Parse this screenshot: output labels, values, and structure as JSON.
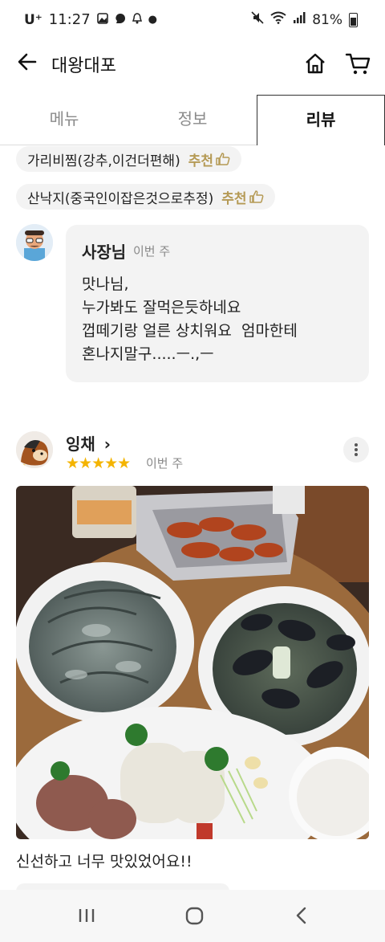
{
  "status": {
    "carrier": "U⁺",
    "time": "11:27",
    "battery": "81%",
    "left_icons": [
      "gallery-icon",
      "notification-icon",
      "bell-icon",
      "dot-icon"
    ],
    "right_icons": [
      "mute-icon",
      "wifi-icon",
      "signal-icon",
      "battery-icon"
    ]
  },
  "appbar": {
    "title": "대왕대포",
    "icons": [
      "back-arrow-icon",
      "home-icon",
      "cart-icon"
    ]
  },
  "tabs": [
    {
      "label": "메뉴",
      "active": false
    },
    {
      "label": "정보",
      "active": false
    },
    {
      "label": "리뷰",
      "active": true
    }
  ],
  "menu_chips": [
    {
      "name": "가리비찜(강추,이건더편해)",
      "rec": "추천"
    },
    {
      "name": "산낙지(중국인이잡은것으로추정)",
      "rec": "추천"
    }
  ],
  "owner_reply": {
    "name": "사장님",
    "when": "이번 주",
    "lines": [
      "맛나님,",
      "누가봐도 잘먹은듯하네요",
      "껍떼기랑 얼른 상치워요  엄마한테",
      "혼나지말구.....ㅡ.,ㅡ"
    ]
  },
  "review": {
    "reviewer": "잉채",
    "chevron": "›",
    "rating": 5,
    "stars": "★★★★★",
    "when": "이번 주",
    "text": "신선하고 너무 맛있었어요!!",
    "photo": "food-photo: seafood platter with raw shrimp, grilled shrimp, mussel soup, sliced squid, rice"
  },
  "colors": {
    "accent_gold": "#b59a55",
    "star": "#f4b400",
    "chip_bg": "#f3f3f3",
    "active_tab_border": "#333333"
  },
  "nav": {
    "icons": [
      "recent-apps-icon",
      "home-nav-icon",
      "back-nav-icon"
    ]
  }
}
